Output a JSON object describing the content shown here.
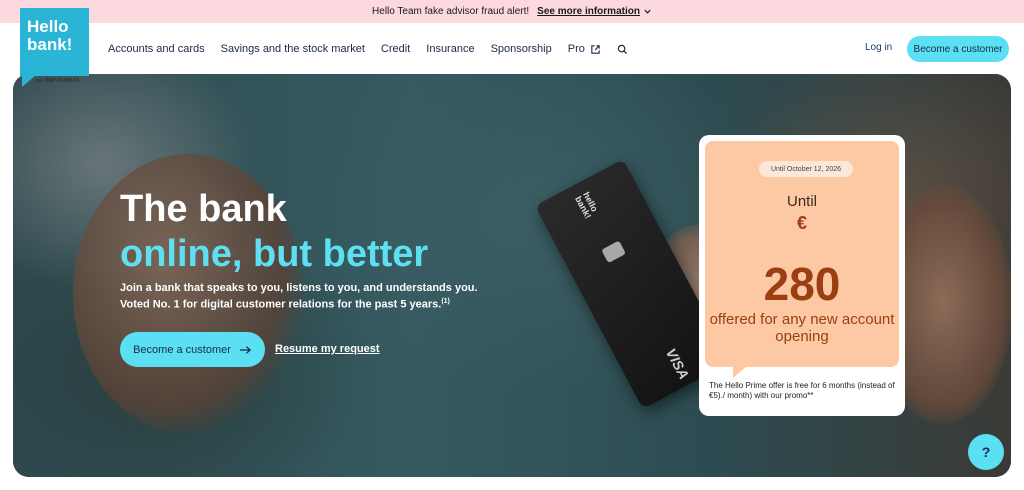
{
  "alert": {
    "message": "Hello Team fake advisor fraud alert!",
    "link": "See more information"
  },
  "logo": {
    "line1": "Hello",
    "line2": "bank!",
    "sub": "par BNP PARIBAS"
  },
  "nav": {
    "items": [
      {
        "label": "Accounts and cards"
      },
      {
        "label": "Savings and the stock market"
      },
      {
        "label": "Credit"
      },
      {
        "label": "Insurance"
      },
      {
        "label": "Sponsorship"
      },
      {
        "label": "Pro"
      }
    ],
    "login": "Log in",
    "cta": "Become a customer"
  },
  "hero": {
    "headline_line1": "The bank",
    "headline_line2": "online, but better",
    "sub_text": "Join a bank that speaks to you, listens to you, and understands you. Voted No. 1 for digital customer relations for the past 5 years.",
    "sub_note": "(1)",
    "cta": "Become a customer",
    "resume": "Resume my request",
    "card_brand": "hello bank!",
    "card_network": "VISA"
  },
  "promo": {
    "date": "Until October 12, 2026",
    "until": "Until",
    "currency": "€",
    "amount": "280",
    "offered": "offered for any new account opening",
    "note": "The Hello Prime offer is free for 6 months (instead of €5)./ month) with our promo**"
  },
  "help": {
    "label": "?"
  },
  "colors": {
    "accent": "#5bdff2",
    "logo": "#2ab5d6",
    "alert_bg": "#fbd9de",
    "promo_bg": "#fdc8a4",
    "promo_text": "#9b3e12"
  },
  "icons": {
    "external": "external-link-icon",
    "search": "search-icon",
    "arrow": "arrow-right-icon",
    "chevron": "chevron-down-icon"
  }
}
